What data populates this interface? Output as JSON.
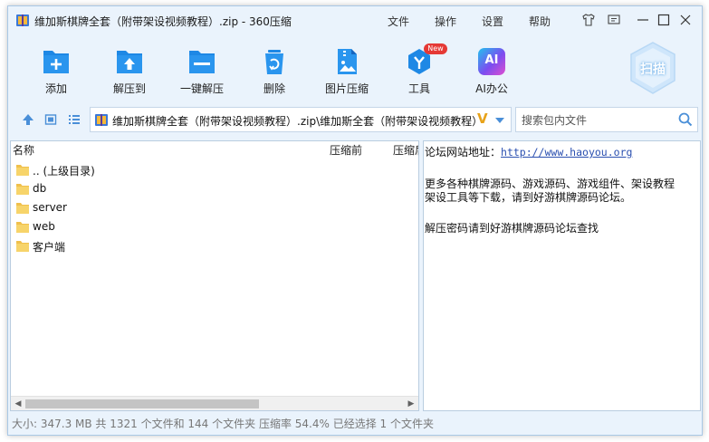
{
  "window": {
    "title": "维加斯棋牌全套（附带架设视频教程）.zip - 360压缩"
  },
  "menu": [
    "文件",
    "操作",
    "设置",
    "帮助"
  ],
  "toolbar": {
    "add": "添加",
    "extract_to": "解压到",
    "one_click": "一键解压",
    "delete": "删除",
    "image_compress": "图片压缩",
    "tools": "工具",
    "tools_badge": "New",
    "ai_office": "AI办公",
    "ai_icon_text": "AI",
    "scan": "扫描"
  },
  "address": {
    "path": "维加斯棋牌全套（附带架设视频教程）.zip\\维加斯全套（附带架设视频教程）",
    "search_placeholder": "搜索包内文件"
  },
  "file_list": {
    "columns": [
      "名称",
      "压缩前",
      "压缩后"
    ],
    "items": [
      ".. (上级目录)",
      "db",
      "server",
      "web",
      "客户端"
    ]
  },
  "info": {
    "forum_label": "论坛网站地址：",
    "forum_url": "http://www.haoyou.org",
    "line2": "更多各种棋牌源码、游戏源码、游戏组件、架设教程",
    "line3": "架设工具等下载，请到好游棋牌源码论坛。",
    "line4": "解压密码请到好游棋牌源码论坛查找"
  },
  "status": {
    "text": "大小: 347.3 MB 共 1321 个文件和 144 个文件夹 压缩率 54.4% 已经选择 1 个文件夹"
  },
  "colors": {
    "accent": "#1e88e5",
    "window_bg": "#eaf3fc",
    "link": "#2a4fb0",
    "folder": "#f7cf61",
    "badge": "#e53935"
  }
}
